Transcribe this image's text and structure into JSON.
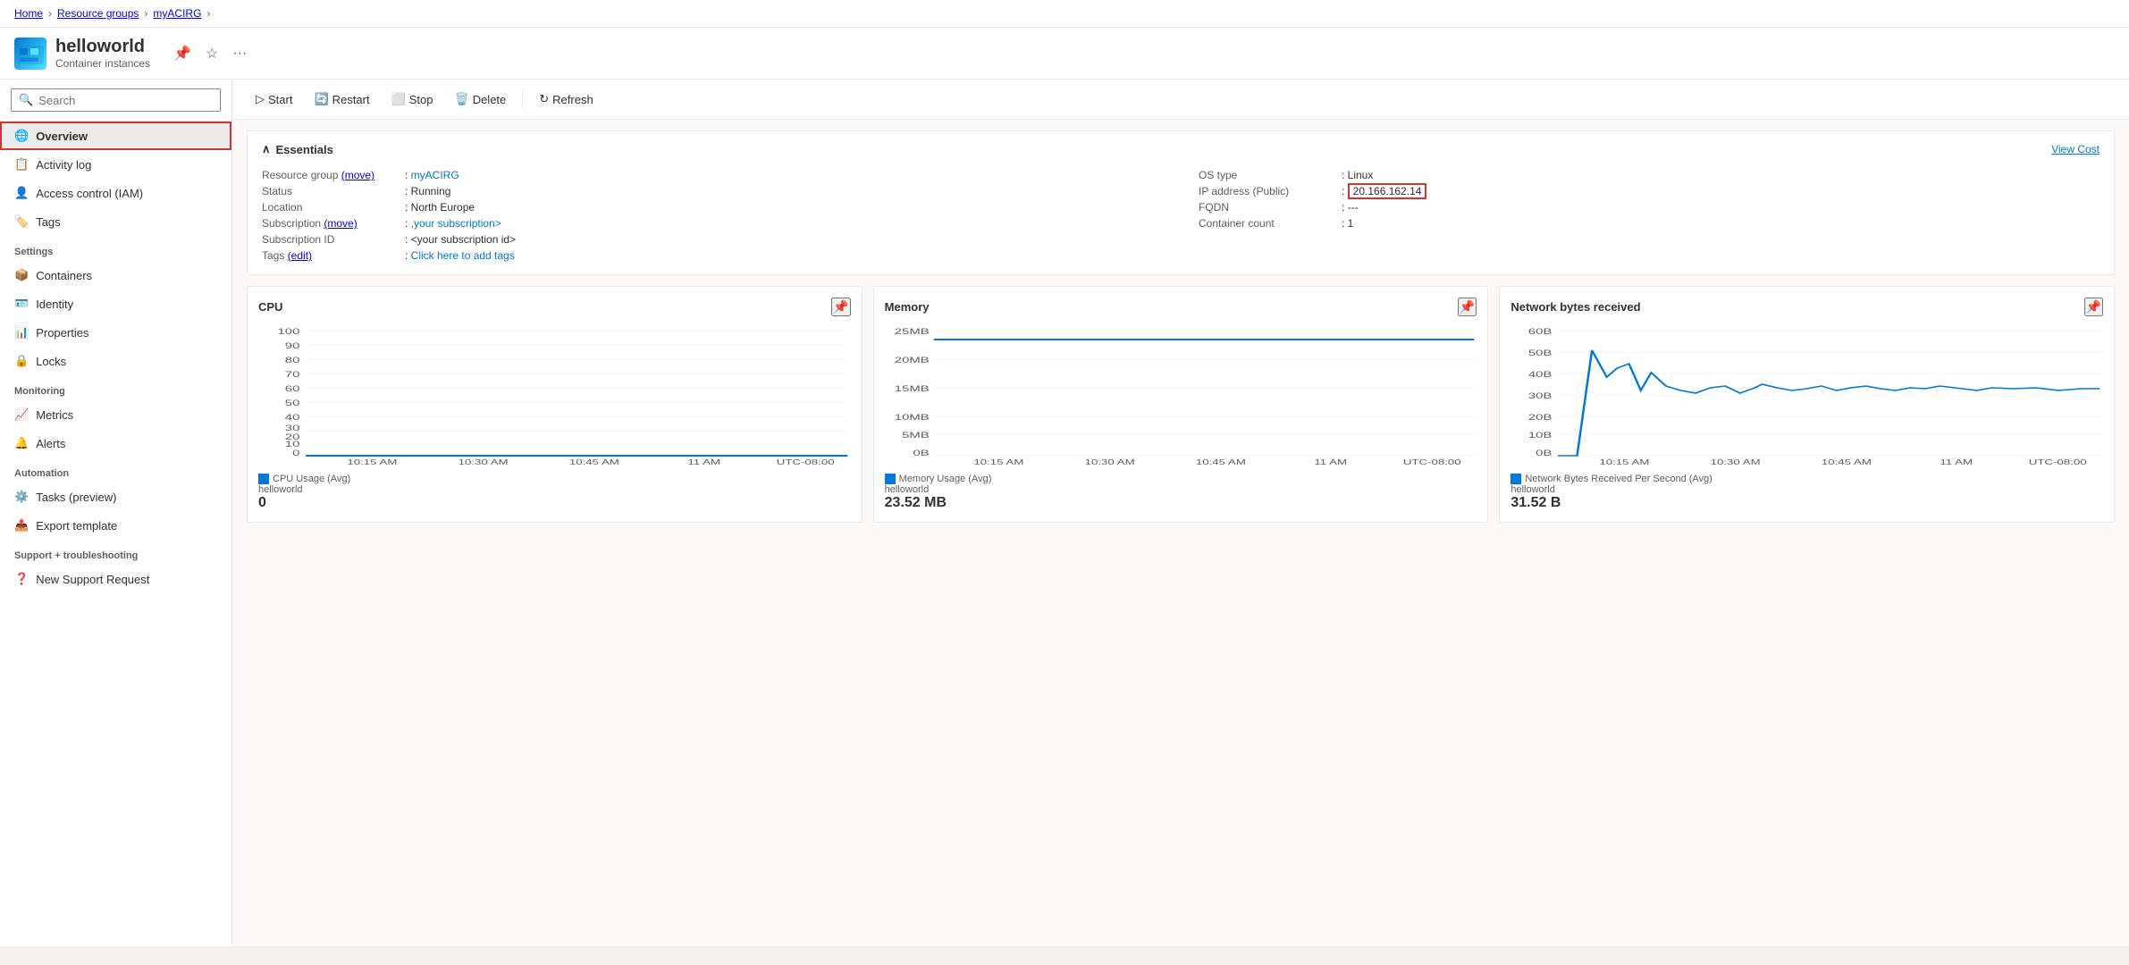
{
  "breadcrumb": {
    "items": [
      "Home",
      "Resource groups",
      "myACIRG"
    ]
  },
  "header": {
    "icon": "🐳",
    "title": "helloworld",
    "subtitle": "Container instances",
    "actions": [
      "pin",
      "star",
      "more"
    ]
  },
  "toolbar": {
    "start_label": "Start",
    "restart_label": "Restart",
    "stop_label": "Stop",
    "delete_label": "Delete",
    "refresh_label": "Refresh"
  },
  "sidebar": {
    "search_placeholder": "Search",
    "items": [
      {
        "id": "overview",
        "label": "Overview",
        "icon": "globe",
        "active": true
      },
      {
        "id": "activity-log",
        "label": "Activity log",
        "icon": "list"
      },
      {
        "id": "access-control",
        "label": "Access control (IAM)",
        "icon": "person"
      },
      {
        "id": "tags",
        "label": "Tags",
        "icon": "tag"
      }
    ],
    "sections": [
      {
        "label": "Settings",
        "items": [
          {
            "id": "containers",
            "label": "Containers",
            "icon": "box"
          },
          {
            "id": "identity",
            "label": "Identity",
            "icon": "id"
          },
          {
            "id": "properties",
            "label": "Properties",
            "icon": "properties"
          },
          {
            "id": "locks",
            "label": "Locks",
            "icon": "lock"
          }
        ]
      },
      {
        "label": "Monitoring",
        "items": [
          {
            "id": "metrics",
            "label": "Metrics",
            "icon": "chart"
          },
          {
            "id": "alerts",
            "label": "Alerts",
            "icon": "alert"
          }
        ]
      },
      {
        "label": "Automation",
        "items": [
          {
            "id": "tasks",
            "label": "Tasks (preview)",
            "icon": "task"
          },
          {
            "id": "export-template",
            "label": "Export template",
            "icon": "export"
          }
        ]
      },
      {
        "label": "Support + troubleshooting",
        "items": [
          {
            "id": "new-support",
            "label": "New Support Request",
            "icon": "support"
          }
        ]
      }
    ]
  },
  "essentials": {
    "title": "Essentials",
    "view_cost_label": "View Cost",
    "left": [
      {
        "label": "Resource group (move)",
        "value": "myACIRG",
        "link": true,
        "link_text": "myACIRG"
      },
      {
        "label": "Status",
        "value": "Running"
      },
      {
        "label": "Location",
        "value": "North Europe"
      },
      {
        "label": "Subscription (move)",
        "value": ",your subscription>",
        "link": true,
        "link_text": ",your subscription>"
      },
      {
        "label": "Subscription ID",
        "value": "<your subscription id>"
      },
      {
        "label": "Tags (edit)",
        "value": "Click here to add tags",
        "link": true,
        "link_text": "Click here to add tags"
      }
    ],
    "right": [
      {
        "label": "OS type",
        "value": "Linux"
      },
      {
        "label": "IP address (Public)",
        "value": "20.166.162.14",
        "highlight": true
      },
      {
        "label": "FQDN",
        "value": "---"
      },
      {
        "label": "Container count",
        "value": "1"
      }
    ]
  },
  "charts": [
    {
      "id": "cpu",
      "title": "CPU",
      "legend_label": "CPU Usage (Avg)",
      "legend_sub": "helloworld",
      "value": "0",
      "time_labels": [
        "10:15 AM",
        "10:30 AM",
        "10:45 AM",
        "11 AM",
        "UTC-08:00"
      ],
      "type": "flat"
    },
    {
      "id": "memory",
      "title": "Memory",
      "legend_label": "Memory Usage (Avg)",
      "legend_sub": "helloworld",
      "value": "23.52 MB",
      "y_labels": [
        "25MB",
        "20MB",
        "15MB",
        "10MB",
        "5MB",
        "0B"
      ],
      "time_labels": [
        "10:15 AM",
        "10:30 AM",
        "10:45 AM",
        "11 AM",
        "UTC-08:00"
      ],
      "type": "flat_high"
    },
    {
      "id": "network",
      "title": "Network bytes received",
      "legend_label": "Network Bytes Received Per Second (Avg)",
      "legend_sub": "helloworld",
      "value": "31.52 B",
      "y_labels": [
        "60B",
        "50B",
        "40B",
        "30B",
        "20B",
        "10B",
        "0B"
      ],
      "time_labels": [
        "10:15 AM",
        "10:30 AM",
        "10:45 AM",
        "11 AM",
        "UTC-08:00"
      ],
      "type": "spiky"
    }
  ]
}
